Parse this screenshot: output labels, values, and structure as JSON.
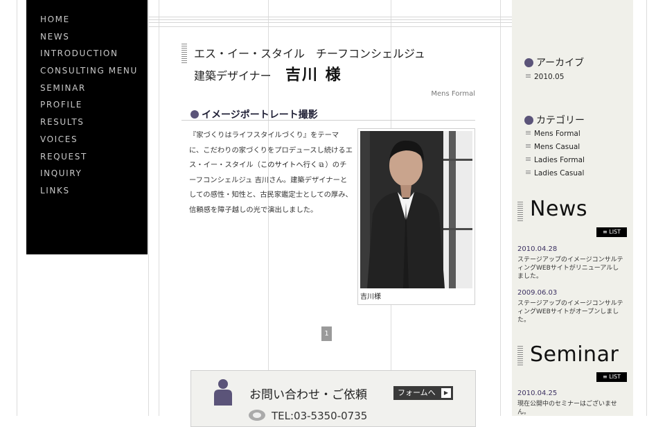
{
  "nav": {
    "items": [
      "HOME",
      "NEWS",
      "INTRODUCTION",
      "CONSULTING MENU",
      "SEMINAR",
      "PROFILE",
      "RESULTS",
      "VOICES",
      "REQUEST",
      "INQUIRY",
      "LINKS"
    ]
  },
  "article": {
    "title_line1": "エス・イー・スタイル　チーフコンシェルジュ",
    "title_prefix": "建築デザイナー",
    "title_name": "吉川 様",
    "category": "Mens Formal",
    "section_heading": "イメージポートレート撮影",
    "body_part1": "『家づくりはライフスタイルづくり』をテーマに、こだわりの家づくりをプロデュースし続けるエス・イー・スタイル（",
    "body_link": "このサイトへ行く",
    "body_part2": "）のチーフコンシェルジュ 吉川さん。建築デザイナーとしての感性・知性と、古民家鑑定士としての厚み、信頼感を障子越しの光で演出しました。",
    "photo_caption": "吉川様",
    "page_number": "1"
  },
  "contact": {
    "title": "お問い合わせ・ご依頼",
    "button_label": "フォームへ",
    "tel": "TEL:03-5350-0735"
  },
  "sidebar": {
    "archive_heading": "アーカイブ",
    "archive_items": [
      "2010.05"
    ],
    "category_heading": "カテゴリー",
    "category_items": [
      "Mens Formal",
      "Mens Casual",
      "Ladies Formal",
      "Ladies Casual"
    ],
    "news_title": "News",
    "news_list_label": "≡ LIST",
    "news": [
      {
        "date": "2010.04.28",
        "text": "ステージアップのイメージコンサルティングWEBサイトがリニューアルしました。"
      },
      {
        "date": "2009.06.03",
        "text": "ステージアップのイメージコンサルティングWEBサイトがオープンしました。"
      }
    ],
    "seminar_title": "Seminar",
    "seminar_list_label": "≡ LIST",
    "seminar": [
      {
        "date": "2010.04.25",
        "text": "現在公開中のセミナーはございません。"
      }
    ]
  },
  "colors": {
    "nav_bg": "#000000",
    "accent_purple": "#5b5479",
    "sidebar_bg": "#f0f0ea"
  }
}
